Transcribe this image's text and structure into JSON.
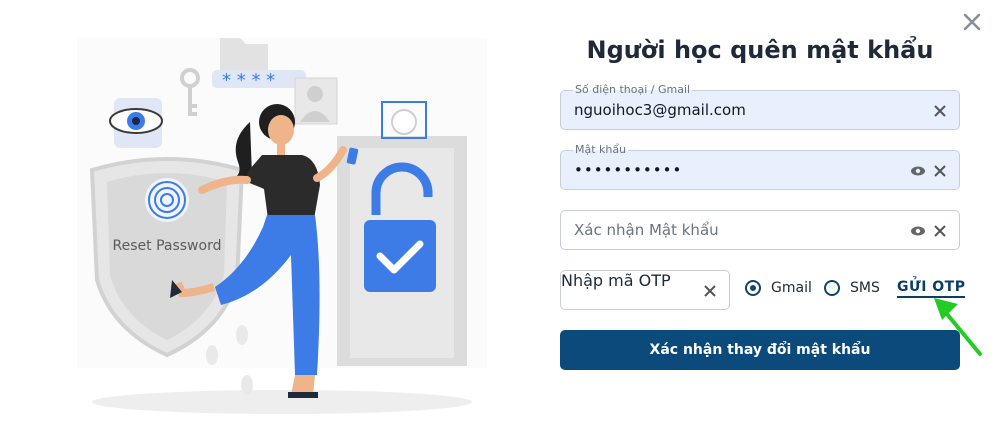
{
  "title": "Người học quên mật khẩu",
  "illustration": {
    "shield_text": "Reset Password"
  },
  "fields": {
    "account": {
      "label": "Số điện thoại / Gmail",
      "value": "nguoihoc3@gmail.com"
    },
    "password": {
      "label": "Mật khẩu",
      "value": "•••••••••••"
    },
    "confirm": {
      "placeholder": "Xác nhận Mật khẩu"
    },
    "otp": {
      "placeholder": "Nhập mã OTP"
    }
  },
  "otp_method": {
    "options": [
      {
        "label": "Gmail",
        "selected": true
      },
      {
        "label": "SMS",
        "selected": false
      }
    ],
    "send_label": "GỬI OTP"
  },
  "submit_label": "Xác nhận thay đổi mật khẩu",
  "colors": {
    "primary": "#0b4a7a",
    "field_fill": "#e8f0fe",
    "arrow": "#22cc22",
    "illustration_blue": "#3d7be6"
  }
}
